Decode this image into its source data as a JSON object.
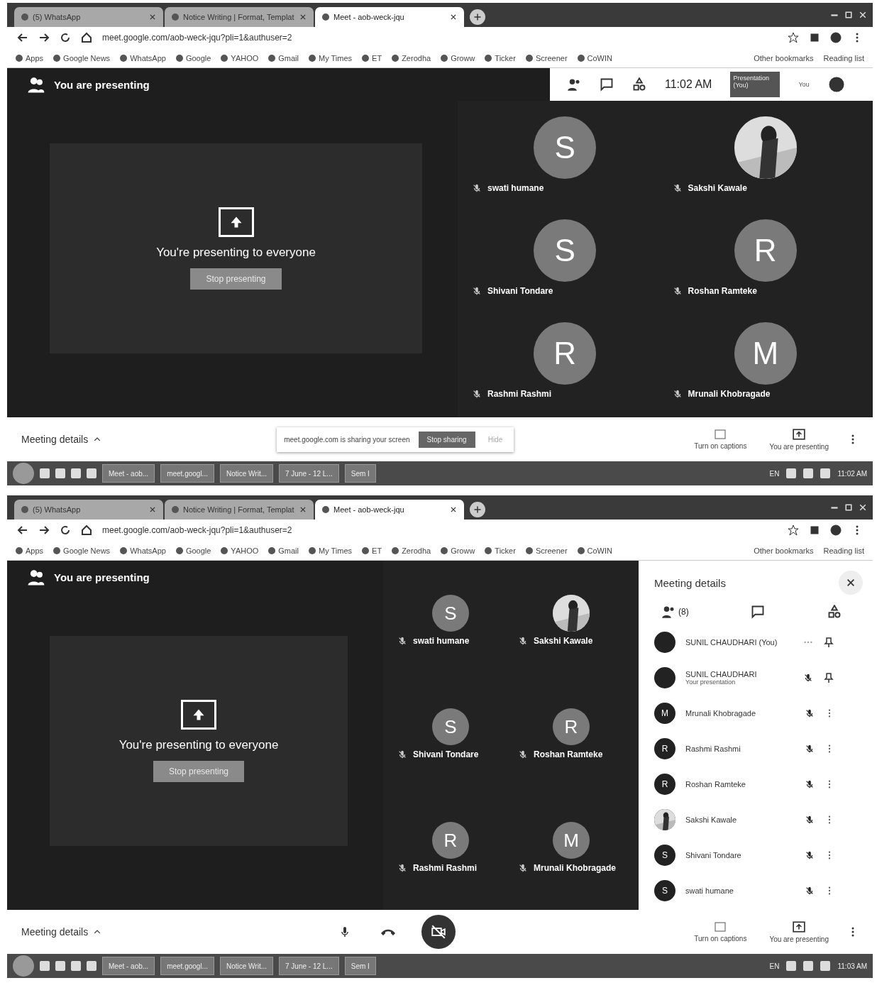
{
  "screenshots": [
    {
      "browser": {
        "tabs": [
          {
            "label": "(5) WhatsApp",
            "selected": false
          },
          {
            "label": "Notice Writing | Format, Templat",
            "selected": false
          },
          {
            "label": "Meet - aob-weck-jqu",
            "selected": true
          }
        ],
        "url": "meet.google.com/aob-weck-jqu?pli=1&authuser=2",
        "bookmarks": [
          "Apps",
          "Google News",
          "WhatsApp",
          "Google",
          "YAHOO",
          "Gmail",
          "My Times",
          "ET",
          "Zerodha",
          "Groww",
          "Ticker",
          "Screener",
          "CoWIN"
        ],
        "other_bookmarks": "Other bookmarks",
        "reading_list": "Reading list"
      },
      "meet": {
        "header": "You are presenting",
        "info_bar": {
          "time": "11:02 AM",
          "presentation": "Presentation (You)",
          "you": "You"
        },
        "card": {
          "message": "You're presenting to everyone",
          "button": "Stop presenting"
        },
        "tiles": [
          {
            "name": "swati humane",
            "initial": "S",
            "kind": "letter"
          },
          {
            "name": "Sakshi Kawale",
            "kind": "picture"
          },
          {
            "name": "Shivani Tondare",
            "initial": "S",
            "kind": "letter"
          },
          {
            "name": "Roshan Ramteke",
            "initial": "R",
            "kind": "letter"
          },
          {
            "name": "Rashmi Rashmi",
            "initial": "R",
            "kind": "letter"
          },
          {
            "name": "Mrunali Khobragade",
            "initial": "M",
            "kind": "letter"
          }
        ]
      },
      "bottom_bar": {
        "details": "Meeting details",
        "sharing_notice": {
          "text": "meet.google.com is sharing your screen",
          "stop": "Stop sharing",
          "hide": "Hide"
        },
        "captions": "Turn on captions",
        "presenting": "You are presenting"
      },
      "taskbar": {
        "items": [
          "Meet - aob...",
          "meet.googl...",
          "Notice Writ...",
          "7 June - 12 L...",
          "Sem I"
        ],
        "language": "EN",
        "time": "11:02 AM"
      }
    },
    {
      "browser": {
        "tabs": [
          {
            "label": "(5) WhatsApp",
            "selected": false
          },
          {
            "label": "Notice Writing | Format, Templat",
            "selected": false
          },
          {
            "label": "Meet - aob-weck-jqu",
            "selected": true
          }
        ],
        "url": "meet.google.com/aob-weck-jqu?pli=1&authuser=2",
        "bookmarks": [
          "Apps",
          "Google News",
          "WhatsApp",
          "Google",
          "YAHOO",
          "Gmail",
          "My Times",
          "ET",
          "Zerodha",
          "Groww",
          "Ticker",
          "Screener",
          "CoWIN"
        ],
        "other_bookmarks": "Other bookmarks",
        "reading_list": "Reading list"
      },
      "meet": {
        "header": "You are presenting",
        "card": {
          "message": "You're presenting to everyone",
          "button": "Stop presenting"
        },
        "tiles": [
          {
            "name": "swati humane",
            "initial": "S",
            "kind": "letter"
          },
          {
            "name": "Sakshi Kawale",
            "kind": "picture"
          },
          {
            "name": "Shivani Tondare",
            "initial": "S",
            "kind": "letter"
          },
          {
            "name": "Roshan Ramteke",
            "initial": "R",
            "kind": "letter"
          },
          {
            "name": "Rashmi Rashmi",
            "initial": "R",
            "kind": "letter"
          },
          {
            "name": "Mrunali Khobragade",
            "initial": "M",
            "kind": "letter"
          }
        ],
        "side_panel": {
          "title": "Meeting details",
          "count": "(8)",
          "participants": [
            {
              "name": "SUNIL CHAUDHARI (You)",
              "kind": "self"
            },
            {
              "name": "SUNIL CHAUDHARI",
              "note": "Your presentation",
              "kind": "presentation"
            },
            {
              "name": "Mrunali Khobragade",
              "initial": "M",
              "kind": "letter"
            },
            {
              "name": "Rashmi Rashmi",
              "initial": "R",
              "kind": "letter"
            },
            {
              "name": "Roshan Ramteke",
              "initial": "R",
              "kind": "letter"
            },
            {
              "name": "Sakshi Kawale",
              "kind": "picture"
            },
            {
              "name": "Shivani Tondare",
              "initial": "S",
              "kind": "letter"
            },
            {
              "name": "swati humane",
              "initial": "S",
              "kind": "letter"
            }
          ]
        }
      },
      "bottom_bar": {
        "details": "Meeting details",
        "camera_on": false,
        "captions": "Turn on captions",
        "presenting": "You are presenting"
      },
      "taskbar": {
        "items": [
          "Meet - aob...",
          "meet.googl...",
          "Notice Writ...",
          "7 June - 12 L...",
          "Sem I"
        ],
        "language": "EN",
        "time": "11:03 AM"
      }
    }
  ]
}
